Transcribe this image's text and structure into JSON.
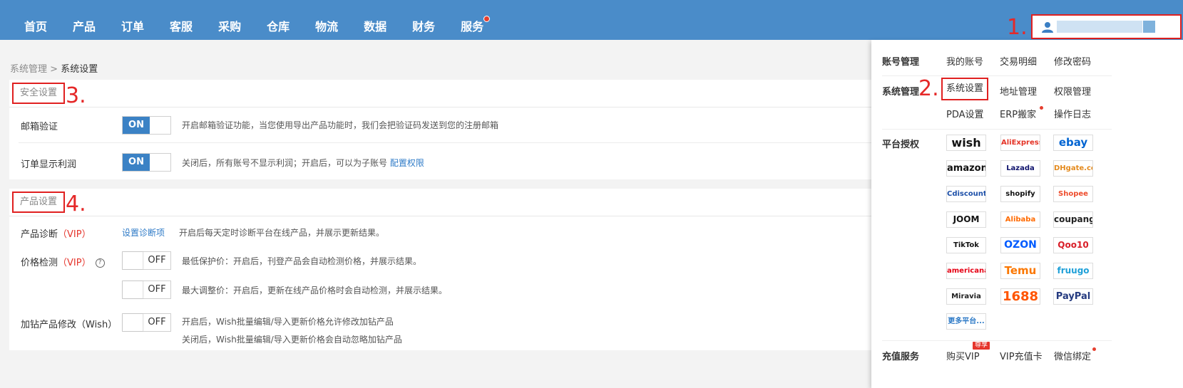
{
  "nav": {
    "items": [
      "首页",
      "产品",
      "订单",
      "客服",
      "采购",
      "仓库",
      "物流",
      "数据",
      "财务",
      "服务"
    ],
    "has_dot_index": 9
  },
  "annotations": [
    "1.",
    "2.",
    "3.",
    "4."
  ],
  "breadcrumb": {
    "parent": "系统管理",
    "separator": ">",
    "current": "系统设置"
  },
  "security": {
    "title": "安全设置",
    "rows": [
      {
        "label": "邮箱验证",
        "toggle": "ON",
        "desc": "开启邮箱验证功能，当您使用导出产品功能时，我们会把验证码发送到您的注册邮箱"
      },
      {
        "label": "订单显示利润",
        "toggle": "ON",
        "desc": "关闭后，所有账号不显示利润；开启后，可以为子账号",
        "link": "配置权限"
      }
    ]
  },
  "product": {
    "title": "产品设置",
    "diagnosis": {
      "label": "产品诊断",
      "vip": "（VIP）",
      "link": "设置诊断项",
      "desc": "开启后每天定时诊断平台在线产品，并展示更新结果。"
    },
    "price": {
      "label": "价格检测",
      "vip": "（VIP）",
      "help": "?",
      "toggle1": "OFF",
      "desc1": "最低保护价：开启后，刊登产品会自动检测价格，并展示结果。",
      "toggle2": "OFF",
      "desc2": "最大调整价：开启后，更新在线产品价格时会自动检测，并展示结果。"
    },
    "wish": {
      "label": "加钻产品修改（Wish）",
      "toggle": "OFF",
      "desc1": "开启后，Wish批量编辑/导入更新价格允许修改加钻产品",
      "desc2": "关闭后，Wish批量编辑/导入更新价格会自动忽略加钻产品"
    }
  },
  "dropdown": {
    "account": {
      "label": "账号管理",
      "links": [
        "我的账号",
        "交易明细",
        "修改密码"
      ]
    },
    "system": {
      "label": "系统管理",
      "links": [
        "系统设置",
        "地址管理",
        "权限管理",
        "PDA设置",
        "ERP搬家",
        "操作日志"
      ]
    },
    "platform": {
      "label": "平台授权",
      "tiles": [
        {
          "text": "wish",
          "color": "#111"
        },
        {
          "text": "AliExpress",
          "color": "#e43225"
        },
        {
          "text": "ebay",
          "color": "#0064d2"
        },
        {
          "text": "amazon",
          "color": "#111"
        },
        {
          "text": "Lazada",
          "color": "#0f136d"
        },
        {
          "text": "DHgate.com",
          "color": "#e48a1d"
        },
        {
          "text": "Cdiscount",
          "color": "#1c4fa8"
        },
        {
          "text": "shopify",
          "color": "#111"
        },
        {
          "text": "Shopee",
          "color": "#ee4d2d"
        },
        {
          "text": "JOOM",
          "color": "#111"
        },
        {
          "text": "Alibaba",
          "color": "#ff6a00"
        },
        {
          "text": "coupang",
          "color": "#222"
        },
        {
          "text": "TikTok",
          "color": "#111"
        },
        {
          "text": "OZON",
          "color": "#005bff"
        },
        {
          "text": "Qoo10",
          "color": "#d81e28"
        },
        {
          "text": "americanas",
          "color": "#e60014"
        },
        {
          "text": "Temu",
          "color": "#fb7701"
        },
        {
          "text": "fruugo",
          "color": "#1fa0d8"
        },
        {
          "text": "Miravia",
          "color": "#222"
        },
        {
          "text": "1688",
          "color": "#ff5500"
        },
        {
          "text": "PayPal",
          "color": "#253b80"
        }
      ],
      "more": "更多平台..."
    },
    "recharge": {
      "label": "充值服务",
      "links": [
        "购买VIP",
        "VIP充值卡",
        "微信绑定"
      ],
      "badge": "尊享"
    }
  },
  "colors": {
    "topbar": "#4a8cc9",
    "accent": "#3b82c5",
    "annotation": "#e02020"
  }
}
